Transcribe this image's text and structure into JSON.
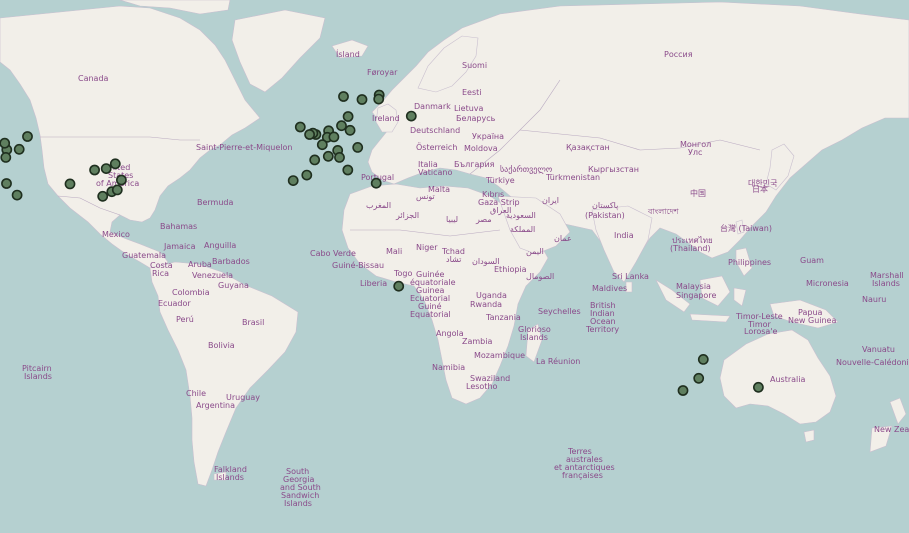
{
  "colors": {
    "ocean": "#b5d0d0",
    "land": "#f2efe9",
    "border": "#b9a9c0",
    "label": "#8a4a8a",
    "marker_fill": "#5f7f5f",
    "marker_stroke": "#1f2f1f"
  },
  "labels": {
    "canada": "Canada",
    "russia": "Россия",
    "usa1": "United",
    "usa2": "States",
    "usa3": "of America",
    "mexico": "Mexico",
    "bermuda": "Bermuda",
    "spm": "Saint-Pierre-et-Miquelon",
    "bahamas": "Bahamas",
    "jamaica": "Jamaica",
    "anguilla": "Anguilla",
    "guatemala": "Guatemala",
    "costarica1": "Costa",
    "costarica2": "Rica",
    "aruba": "Aruba",
    "barbados": "Barbados",
    "venezuela": "Venezuela",
    "colombia": "Colombia",
    "guyana": "Guyana",
    "ecuador": "Ecuador",
    "peru": "Perú",
    "brasil": "Brasil",
    "bolivia": "Bolivia",
    "chile": "Chile",
    "argentina": "Argentina",
    "uruguay": "Uruguay",
    "pitcairn1": "Pitcairn",
    "pitcairn2": "Islands",
    "falkland1": "Falkland",
    "falkland2": "Islands",
    "sgsi1": "South",
    "sgsi2": "Georgia",
    "sgsi3": "and South",
    "sgsi4": "Sandwich",
    "sgsi5": "Islands",
    "island": "Ísland",
    "foroyar": "Føroyar",
    "suomi": "Suomi",
    "eesti": "Eesti",
    "danmark": "Danmark",
    "lietuva": "Lietuva",
    "belarus": "Беларусь",
    "ireland": "Ireland",
    "deutschland": "Deutschland",
    "ukraina": "Україна",
    "osterreich": "Österreich",
    "moldova": "Moldova",
    "italia": "Italia",
    "vaticano": "Vaticano",
    "bulgaria": "България",
    "portugal": "Portugal",
    "sakartvelo": "საქართველო",
    "turkiye": "Türkiye",
    "kazakhstan": "Қазақстан",
    "mongolia1": "Монгол",
    "mongolia2": "Улс",
    "turkmenistan": "Türkmenistan",
    "kyrgyzstan": "Кыргызстан",
    "malta": "Malta",
    "tunisia": "تونس",
    "kibris": "Kıbrıs",
    "gaza": "Gaza Strip",
    "iraq": "العراق",
    "iran": "ایران",
    "algeria": "الجزائر",
    "morocco1": "المغرب",
    "morocco2": "المغرب",
    "libya": "ليبيا",
    "egypt": "مصر",
    "saudi1": "السعودية",
    "saudi2": "المملكة",
    "oman": "عمان",
    "yemen": "اليمن",
    "pakistan1": "پاکستان",
    "pakistan2": "(Pakistan)",
    "india": "India",
    "china": "中国",
    "japan": "日本",
    "korea": "대한민국",
    "taiwan": "台灣 (Taiwan)",
    "bangladesh": "বাংলাদেশ",
    "thailand1": "ประเทศไทย",
    "thailand2": "(Thailand)",
    "philippines": "Philippines",
    "guam": "Guam",
    "micronesia": "Micronesia",
    "marshall1": "Marshall",
    "marshall2": "Islands",
    "nauru": "Nauru",
    "srilanka": "Sri Lanka",
    "maldives": "Maldives",
    "malaysia": "Malaysia",
    "singapore": "Singapore",
    "timorleste1": "Timor-Leste",
    "timorleste2": "Timor",
    "timorleste3": "Lorosa'e",
    "png1": "Papua",
    "png2": "New Guinea",
    "vanuatu": "Vanuatu",
    "newcal": "Nouvelle-Calédonie",
    "australia": "Australia",
    "newzealand": "New Zea",
    "caboverde": "Cabo Verde",
    "guineebissau": "Guiné-Bissau",
    "mali": "Mali",
    "niger": "Niger",
    "tchad1": "Tchad",
    "tchad2": "تشاد",
    "sudan": "السودان",
    "ethiopia": "Ethiopia",
    "somalia": "الصومال",
    "togo": "Togo",
    "liberia": "Liberia",
    "guinee1": "Guinée",
    "guinee2": "équatoriale",
    "guinea1": "Guinea",
    "guinea2": "Ecuatorial",
    "guine1": "Guiné",
    "guine2": "Equatorial",
    "uganda": "Uganda",
    "rwanda": "Rwanda",
    "tanzania": "Tanzania",
    "seychelles": "Seychelles",
    "biot1": "British",
    "biot2": "Indian",
    "biot3": "Ocean",
    "biot4": "Territory",
    "glorioso1": "Glorioso",
    "glorioso2": "Islands",
    "angola": "Angola",
    "zambia": "Zambia",
    "mozambique": "Mozambique",
    "namibia": "Namibia",
    "swaziland": "Swaziland",
    "lesotho": "Lesotho",
    "reunion": "La Réunion",
    "taaf1": "Terres",
    "taaf2": "australes",
    "taaf3": "et antarctiques",
    "taaf4": "françaises",
    "bahrain": "البحرين",
    "kuwait": "قطر"
  },
  "markers": [
    {
      "name": "seattle",
      "lon": -122.3,
      "lat": 47.6
    },
    {
      "name": "vancouver",
      "lon": -123.1,
      "lat": 49.3
    },
    {
      "name": "portland",
      "lon": -122.7,
      "lat": 45.5
    },
    {
      "name": "sf",
      "lon": -122.4,
      "lat": 37.8
    },
    {
      "name": "spokane",
      "lon": -117.4,
      "lat": 47.7
    },
    {
      "name": "calgary",
      "lon": -114.1,
      "lat": 51.0
    },
    {
      "name": "los-angeles",
      "lon": -118.2,
      "lat": 34.1
    },
    {
      "name": "wichita",
      "lon": -97.3,
      "lat": 37.7
    },
    {
      "name": "chicago",
      "lon": -87.6,
      "lat": 41.9
    },
    {
      "name": "detroit",
      "lon": -83.0,
      "lat": 42.3
    },
    {
      "name": "toronto",
      "lon": -79.4,
      "lat": 43.7
    },
    {
      "name": "atlanta",
      "lon": -84.4,
      "lat": 33.7
    },
    {
      "name": "charlotte",
      "lon": -80.8,
      "lat": 35.2
    },
    {
      "name": "raleigh",
      "lon": -78.6,
      "lat": 35.8
    },
    {
      "name": "dc",
      "lon": -77.0,
      "lat": 38.9
    },
    {
      "name": "dublin",
      "lon": -6.3,
      "lat": 53.3
    },
    {
      "name": "london",
      "lon": -0.1,
      "lat": 51.5
    },
    {
      "name": "oxford",
      "lon": -1.3,
      "lat": 51.8
    },
    {
      "name": "bristol",
      "lon": -2.6,
      "lat": 51.5
    },
    {
      "name": "amsterdam",
      "lon": 4.9,
      "lat": 52.4
    },
    {
      "name": "brussels",
      "lon": 4.4,
      "lat": 50.8
    },
    {
      "name": "paris",
      "lon": 2.4,
      "lat": 48.9
    },
    {
      "name": "cologne",
      "lon": 7.0,
      "lat": 50.9
    },
    {
      "name": "hamburg",
      "lon": 10.0,
      "lat": 53.6
    },
    {
      "name": "berlin",
      "lon": 13.4,
      "lat": 52.5
    },
    {
      "name": "copenhagen",
      "lon": 12.6,
      "lat": 55.7
    },
    {
      "name": "oslo",
      "lon": 10.8,
      "lat": 59.9
    },
    {
      "name": "stockholm",
      "lon": 18.1,
      "lat": 59.3
    },
    {
      "name": "helsinki",
      "lon": 24.9,
      "lat": 60.2
    },
    {
      "name": "tallinn",
      "lon": 24.7,
      "lat": 59.4
    },
    {
      "name": "moscow",
      "lon": 37.6,
      "lat": 55.8
    },
    {
      "name": "bordeaux",
      "lon": -0.6,
      "lat": 44.8
    },
    {
      "name": "lyon",
      "lon": 4.8,
      "lat": 45.8
    },
    {
      "name": "zurich",
      "lon": 8.5,
      "lat": 47.4
    },
    {
      "name": "vienna",
      "lon": 16.4,
      "lat": 48.2
    },
    {
      "name": "milan",
      "lon": 9.2,
      "lat": 45.5
    },
    {
      "name": "madrid",
      "lon": -3.7,
      "lat": 40.4
    },
    {
      "name": "lisbon",
      "lon": -9.1,
      "lat": 38.7
    },
    {
      "name": "rome",
      "lon": 12.5,
      "lat": 41.9
    },
    {
      "name": "athens",
      "lon": 23.7,
      "lat": 37.9
    },
    {
      "name": "kampala",
      "lon": 32.6,
      "lat": 0.3
    },
    {
      "name": "brisbane",
      "lon": 153.0,
      "lat": -27.5
    },
    {
      "name": "sydney",
      "lon": 151.2,
      "lat": -33.9
    },
    {
      "name": "melbourne",
      "lon": 145.0,
      "lat": -37.8
    },
    {
      "name": "auckland",
      "lon": 174.8,
      "lat": -36.8
    }
  ]
}
